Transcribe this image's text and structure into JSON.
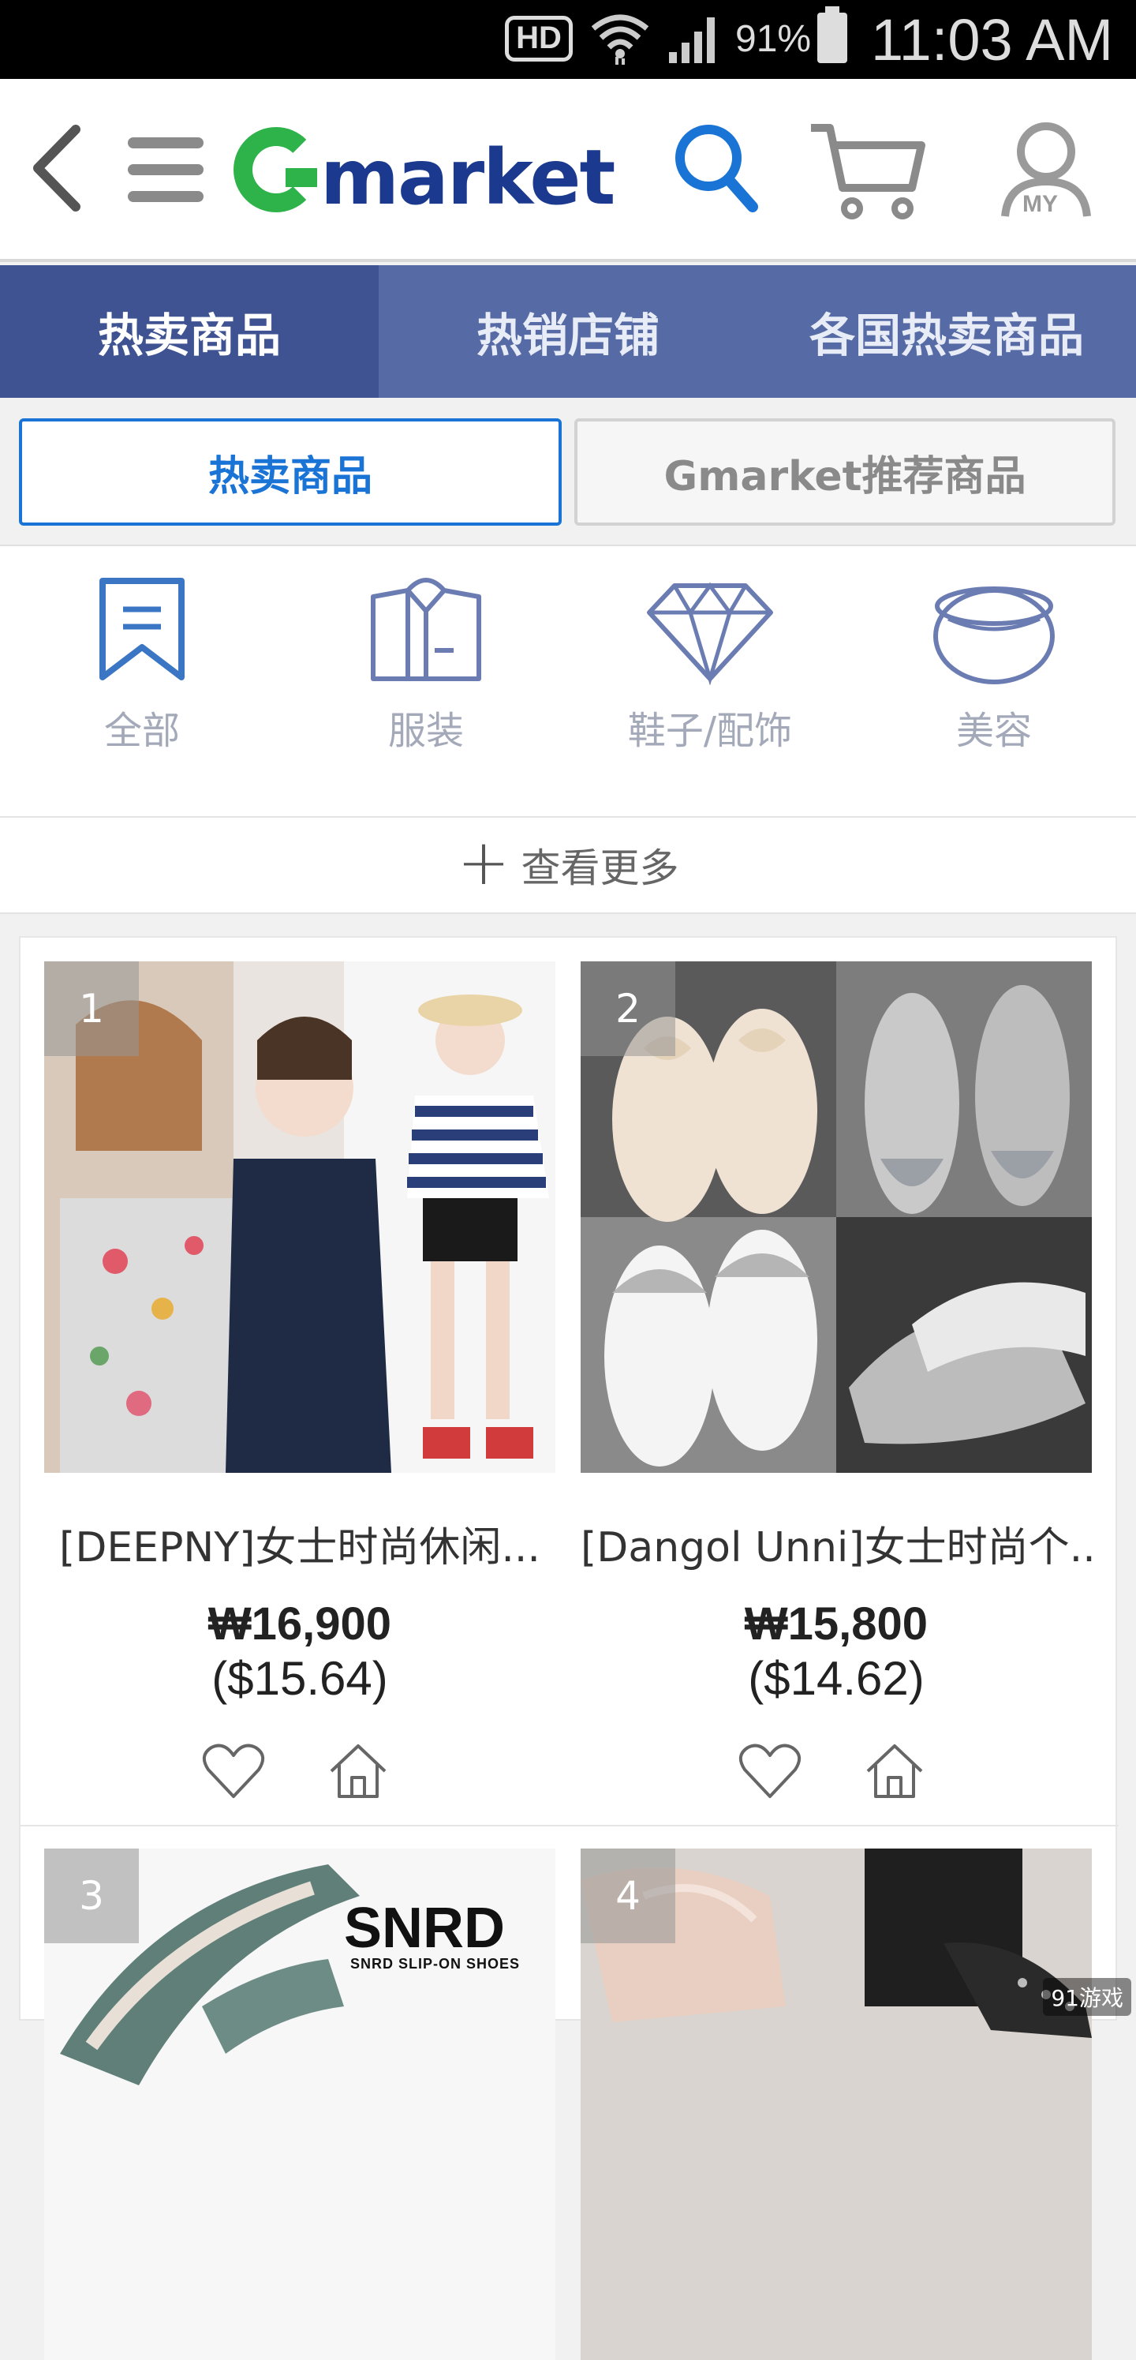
{
  "status_bar": {
    "hd": "HD",
    "battery": "91%",
    "time": "11:03 AM"
  },
  "header": {
    "logo_text": "market",
    "icons": [
      "back-icon",
      "menu-icon",
      "search-icon",
      "cart-icon",
      "my-account-icon"
    ],
    "my_label": "MY"
  },
  "tabs": [
    {
      "label": "热卖商品"
    },
    {
      "label": "热销店铺"
    },
    {
      "label": "各国热卖商品"
    }
  ],
  "subtabs": [
    {
      "label": "热卖商品"
    },
    {
      "label": "Gmarket推荐商品"
    }
  ],
  "categories": [
    {
      "label": "全部",
      "icon": "bookmark-icon"
    },
    {
      "label": "服装",
      "icon": "shirt-icon"
    },
    {
      "label": "鞋子/配饰",
      "icon": "diamond-icon"
    },
    {
      "label": "美容",
      "icon": "compact-icon"
    }
  ],
  "more": {
    "label": "查看更多"
  },
  "products": [
    {
      "rank": "1",
      "name": "[DEEPNY]女士时尚休闲...",
      "price": "₩16,900",
      "usd": "($15.64)"
    },
    {
      "rank": "2",
      "name": "[Dangol Unni]女士时尚个...",
      "price": "₩15,800",
      "usd": "($14.62)"
    },
    {
      "rank": "3",
      "brand_text": "SNRD",
      "brand_sub": "SNRD SLIP-ON SHOES"
    },
    {
      "rank": "4"
    }
  ],
  "watermark": "91游戏",
  "colors": {
    "tab_bg": "#566ba5",
    "tab_active": "#3f5393",
    "accent_blue": "#1a74d6",
    "logo_green": "#2db34a",
    "logo_navy": "#1b3a8f"
  }
}
